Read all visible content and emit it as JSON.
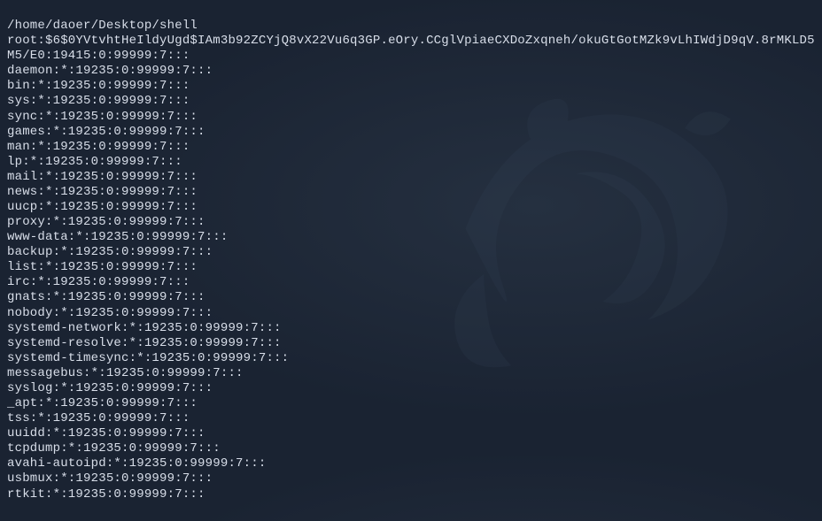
{
  "cwd_line": "/home/daoer/Desktop/shell",
  "shadow_entries": [
    "root:$6$0YVtvhtHeIldyUgd$IAm3b92ZCYjQ8vX22Vu6q3GP.eOry.CCglVpiaeCXDoZxqneh/okuGtGotMZk9vLhIWdjD9qV.8rMKLD5M5/E0:19415:0:99999:7:::",
    "daemon:*:19235:0:99999:7:::",
    "bin:*:19235:0:99999:7:::",
    "sys:*:19235:0:99999:7:::",
    "sync:*:19235:0:99999:7:::",
    "games:*:19235:0:99999:7:::",
    "man:*:19235:0:99999:7:::",
    "lp:*:19235:0:99999:7:::",
    "mail:*:19235:0:99999:7:::",
    "news:*:19235:0:99999:7:::",
    "uucp:*:19235:0:99999:7:::",
    "proxy:*:19235:0:99999:7:::",
    "www-data:*:19235:0:99999:7:::",
    "backup:*:19235:0:99999:7:::",
    "list:*:19235:0:99999:7:::",
    "irc:*:19235:0:99999:7:::",
    "gnats:*:19235:0:99999:7:::",
    "nobody:*:19235:0:99999:7:::",
    "systemd-network:*:19235:0:99999:7:::",
    "systemd-resolve:*:19235:0:99999:7:::",
    "systemd-timesync:*:19235:0:99999:7:::",
    "messagebus:*:19235:0:99999:7:::",
    "syslog:*:19235:0:99999:7:::",
    "_apt:*:19235:0:99999:7:::",
    "tss:*:19235:0:99999:7:::",
    "uuidd:*:19235:0:99999:7:::",
    "tcpdump:*:19235:0:99999:7:::",
    "avahi-autoipd:*:19235:0:99999:7:::",
    "usbmux:*:19235:0:99999:7:::",
    "rtkit:*:19235:0:99999:7:::"
  ]
}
